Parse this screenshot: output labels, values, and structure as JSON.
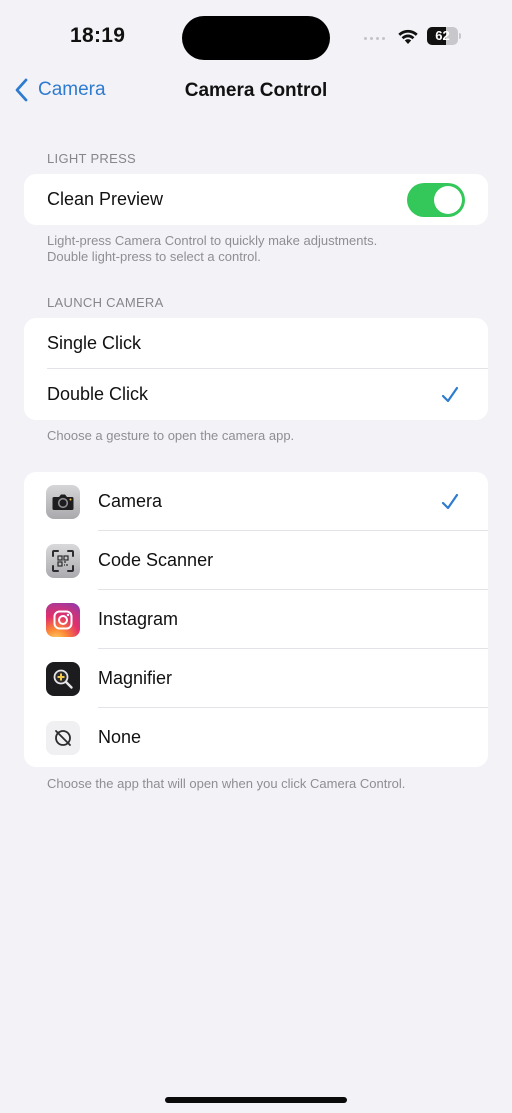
{
  "status_bar": {
    "time": "18:19",
    "battery_level": "62",
    "battery_fraction": 0.62,
    "icons": [
      "cellular-signal-icon",
      "wifi-icon",
      "battery-icon"
    ]
  },
  "nav": {
    "back_label": "Camera",
    "title": "Camera Control",
    "back_icon": "chevron-left-icon"
  },
  "light_press": {
    "header": "LIGHT PRESS",
    "clean_preview_label": "Clean Preview",
    "clean_preview_on": true,
    "footer_line1": "Light-press Camera Control to quickly make adjustments.",
    "footer_line2": "Double light-press to select a control."
  },
  "launch_camera": {
    "header": "LAUNCH CAMERA",
    "options": [
      {
        "label": "Single Click",
        "selected": false
      },
      {
        "label": "Double Click",
        "selected": true
      }
    ],
    "footer": "Choose a gesture to open the camera app."
  },
  "apps": {
    "items": [
      {
        "label": "Camera",
        "icon": "camera-app-icon",
        "selected": true
      },
      {
        "label": "Code Scanner",
        "icon": "code-scanner-icon",
        "selected": false
      },
      {
        "label": "Instagram",
        "icon": "instagram-icon",
        "selected": false
      },
      {
        "label": "Magnifier",
        "icon": "magnifier-icon",
        "selected": false
      },
      {
        "label": "None",
        "icon": "none-icon",
        "selected": false
      }
    ],
    "footer": "Choose the app that will open when you click Camera Control."
  },
  "colors": {
    "accent": "#2f7bd0",
    "toggle_on": "#34c759",
    "background": "#f2f2f7"
  }
}
